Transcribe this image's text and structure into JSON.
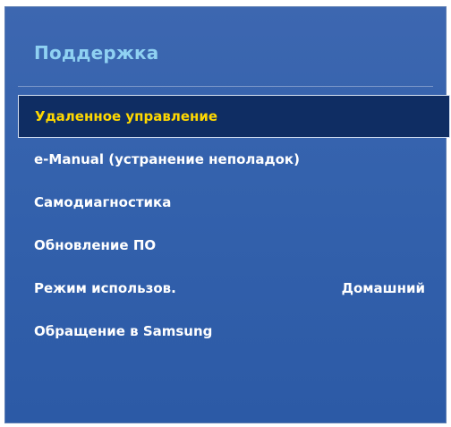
{
  "panel": {
    "title": "Поддержка"
  },
  "menu": {
    "items": [
      {
        "label": "Удаленное управление",
        "value": "",
        "selected": true
      },
      {
        "label": "e-Manual (устранение неполадок)",
        "value": "",
        "selected": false
      },
      {
        "label": "Самодиагностика",
        "value": "",
        "selected": false
      },
      {
        "label": "Обновление ПО",
        "value": "",
        "selected": false
      },
      {
        "label": "Режим использов.",
        "value": "Домашний",
        "selected": false
      },
      {
        "label": "Обращение в Samsung",
        "value": "",
        "selected": false
      }
    ]
  },
  "colors": {
    "title": "#8fd1f2",
    "panel_background": "#3462ad",
    "selected_background": "#0f2d63",
    "selected_text": "#ffd800",
    "text": "#ffffff"
  }
}
